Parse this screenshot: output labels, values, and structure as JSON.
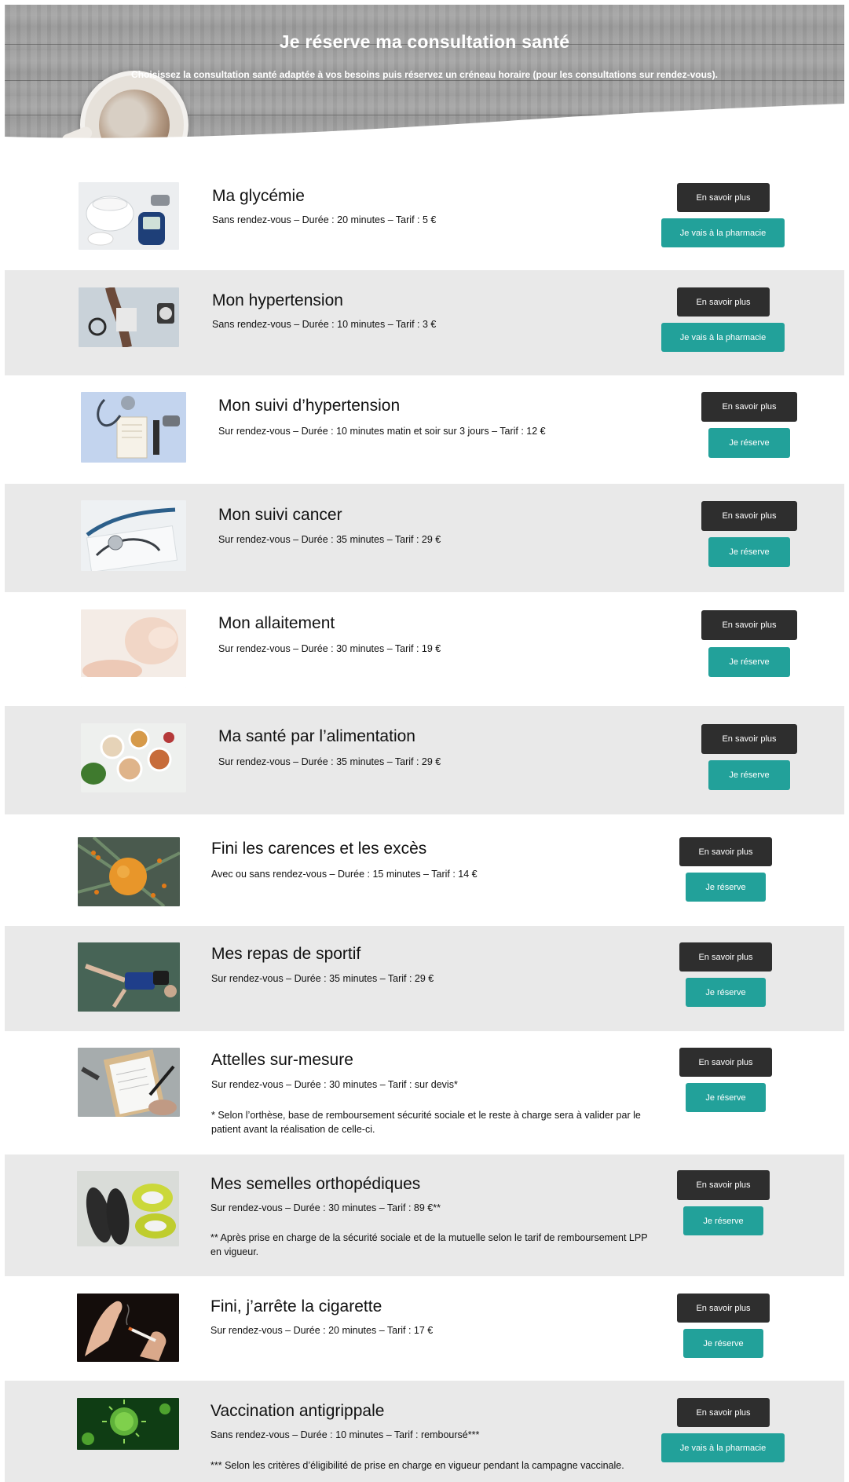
{
  "header": {
    "title": "Je réserve ma consultation santé",
    "subtitle": "Choisissez la consultation santé adaptée à vos besoins puis réservez un créneau horaire (pour les consultations sur rendez-vous)."
  },
  "colors": {
    "button_dark": "#2e2e2e",
    "button_teal": "#22a19a",
    "row_alt": "#e9e9e9"
  },
  "consultations": [
    {
      "title": "Ma glycémie",
      "desc": "Sans rendez-vous – Durée : 20 minutes – Tarif : 5 €",
      "info_label": "En savoir plus",
      "action_label": "Je vais à la pharmacie",
      "image": "glucose-meter-image"
    },
    {
      "title": "Mon hypertension",
      "desc": "Sans rendez-vous – Durée : 10 minutes – Tarif : 3 €",
      "info_label": "En savoir plus",
      "action_label": "Je vais à la pharmacie",
      "image": "blood-pressure-image"
    },
    {
      "title": "Mon suivi d’hypertension",
      "desc": "Sur rendez-vous – Durée : 10 minutes matin et soir sur 3 jours – Tarif : 12 €",
      "info_label": "En savoir plus",
      "action_label": "Je réserve",
      "image": "stethoscope-notebook-image"
    },
    {
      "title": "Mon suivi cancer",
      "desc": "Sur rendez-vous – Durée : 35 minutes – Tarif : 29 €",
      "info_label": "En savoir plus",
      "action_label": "Je réserve",
      "image": "stethoscope-image"
    },
    {
      "title": "Mon allaitement",
      "desc": "Sur rendez-vous – Durée : 30 minutes – Tarif : 19 €",
      "info_label": "En savoir plus",
      "action_label": "Je réserve",
      "image": "sleeping-baby-image"
    },
    {
      "title": "Ma santé par l’alimentation",
      "desc": "Sur rendez-vous – Durée : 35 minutes – Tarif : 29 €",
      "info_label": "En savoir plus",
      "action_label": "Je réserve",
      "image": "healthy-food-image"
    },
    {
      "title": "Fini les carences et les excès",
      "desc": "Avec ou sans rendez-vous – Durée : 15 minutes – Tarif : 14 €",
      "info_label": "En savoir plus",
      "action_label": "Je réserve",
      "image": "sea-buckthorn-juice-image"
    },
    {
      "title": "Mes repas de sportif",
      "desc": "Sur rendez-vous – Durée : 35 minutes – Tarif : 29 €",
      "info_label": "En savoir plus",
      "action_label": "Je réserve",
      "image": "runner-resting-image"
    },
    {
      "title": "Attelles sur-mesure",
      "desc": "Sur rendez-vous – Durée : 30 minutes – Tarif : sur devis*",
      "note": "* Selon l’orthèse, base de remboursement sécurité sociale et le reste à charge sera à valider par le patient avant la réalisation de celle-ci.",
      "info_label": "En savoir plus",
      "action_label": "Je réserve",
      "image": "clipboard-writing-image"
    },
    {
      "title": "Mes semelles orthopédiques",
      "desc": "Sur rendez-vous – Durée : 30 minutes – Tarif : 89 €**",
      "note": "** Après prise en charge de la sécurité sociale et de la mutuelle selon le tarif de remboursement LPP en vigueur.",
      "info_label": "En savoir plus",
      "action_label": "Je réserve",
      "image": "insoles-sneakers-image"
    },
    {
      "title": "Fini, j’arrête la cigarette",
      "desc": "Sur rendez-vous – Durée : 20 minutes – Tarif : 17 €",
      "info_label": "En savoir plus",
      "action_label": "Je réserve",
      "image": "refusing-cigarette-image"
    },
    {
      "title": "Vaccination antigrippale",
      "desc": "Sans rendez-vous – Durée : 10 minutes – Tarif : remboursé***",
      "note": "*** Selon les critères d’éligibilité de prise en charge en vigueur pendant la campagne vaccinale.",
      "info_label": "En savoir plus",
      "action_label": "Je vais à la pharmacie",
      "image": "virus-image"
    }
  ]
}
